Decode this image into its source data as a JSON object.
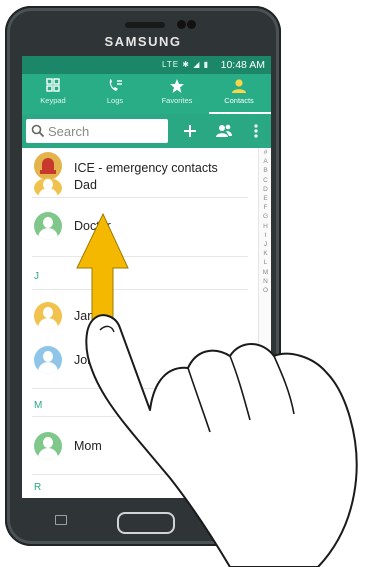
{
  "device": {
    "brand": "SAMSUNG"
  },
  "status_bar": {
    "icons": "LTE ✱ ◢ ▮",
    "time": "10:48 AM"
  },
  "tabs": [
    {
      "label": "Keypad",
      "icon": "keypad-icon"
    },
    {
      "label": "Logs",
      "icon": "logs-icon"
    },
    {
      "label": "Favorites",
      "icon": "star-icon"
    },
    {
      "label": "Contacts",
      "icon": "person-icon",
      "active": true
    }
  ],
  "search": {
    "placeholder": "Search",
    "add_icon": "plus-icon",
    "group_icon": "groups-icon",
    "menu_icon": "more-vert-icon"
  },
  "contacts": {
    "ice": "ICE - emergency contacts",
    "rows": [
      {
        "name": "Dad",
        "avatar": "yellow"
      },
      {
        "name": "Doctor",
        "avatar": "green"
      },
      {
        "section": "J"
      },
      {
        "name": "Jane",
        "avatar": "yellow"
      },
      {
        "name": "John",
        "avatar": "blue"
      },
      {
        "section": "M"
      },
      {
        "name": "Mom",
        "avatar": "green"
      },
      {
        "section": "R"
      }
    ],
    "section_J": "J",
    "section_M": "M",
    "section_R": "R",
    "name_dad": "Dad",
    "name_doctor": "Doctor",
    "name_jane": "Jane",
    "name_john": "John",
    "name_mom": "Mom"
  },
  "index": [
    "#",
    "A",
    "B",
    "C",
    "D",
    "E",
    "F",
    "G",
    "H",
    "I",
    "J",
    "K",
    "L",
    "M",
    "N",
    "O"
  ],
  "colors": {
    "statusbar": "#1b8768",
    "tabs": "#28ad87",
    "arrow": "#f4b800"
  },
  "gesture": {
    "direction": "swipe-up",
    "icon": "hand-pointer-icon"
  }
}
